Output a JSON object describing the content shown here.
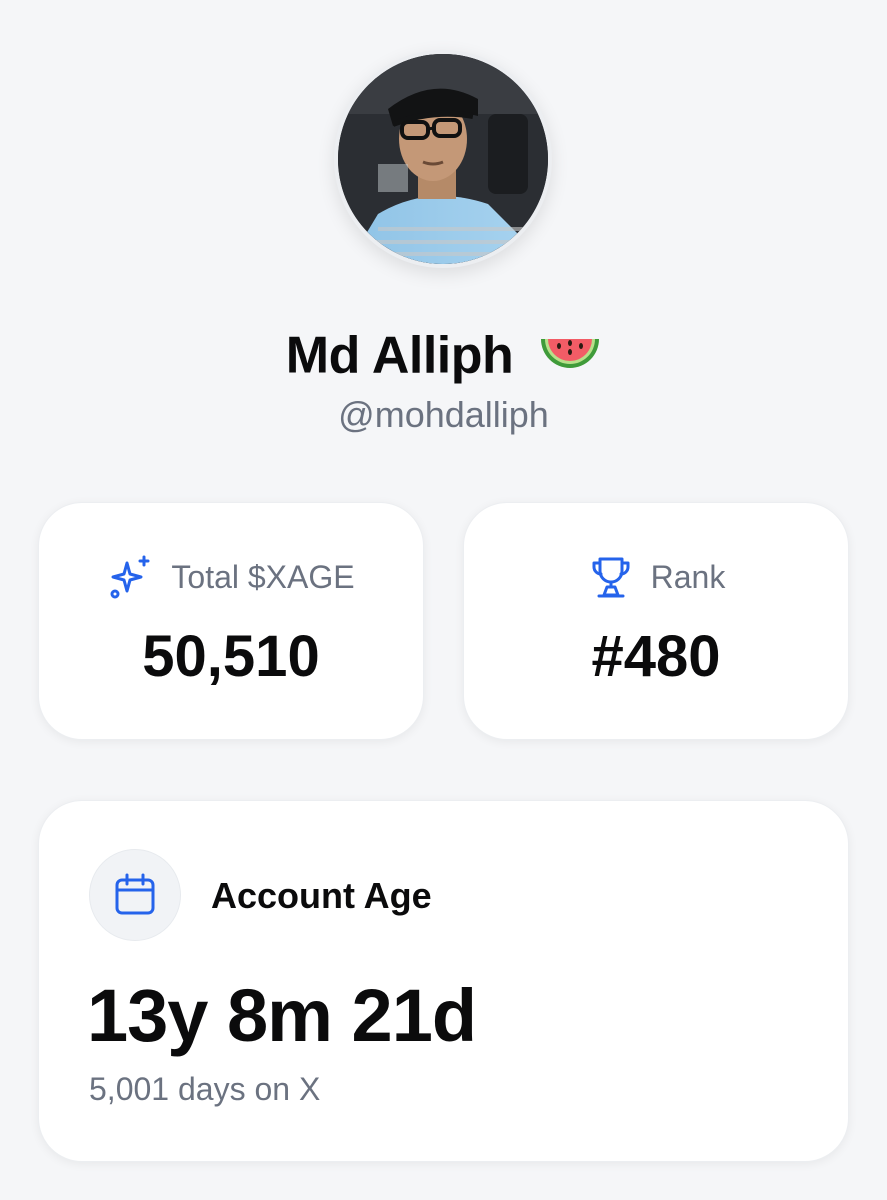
{
  "profile": {
    "display_name": "Md Alliph",
    "name_emoji": "watermelon-icon",
    "handle": "@mohdalliph",
    "avatar": "avatar"
  },
  "stats": {
    "total": {
      "icon": "sparkles-icon",
      "label": "Total $XAGE",
      "value": "50,510"
    },
    "rank": {
      "icon": "trophy-icon",
      "label": "Rank",
      "value": "#480"
    }
  },
  "account_age": {
    "icon": "calendar-icon",
    "title": "Account Age",
    "value": "13y 8m 21d",
    "subtitle": "5,001 days on X"
  },
  "colors": {
    "accent": "#2563eb",
    "background": "#f5f6f8",
    "card": "#ffffff",
    "muted_text": "#6b7280"
  }
}
